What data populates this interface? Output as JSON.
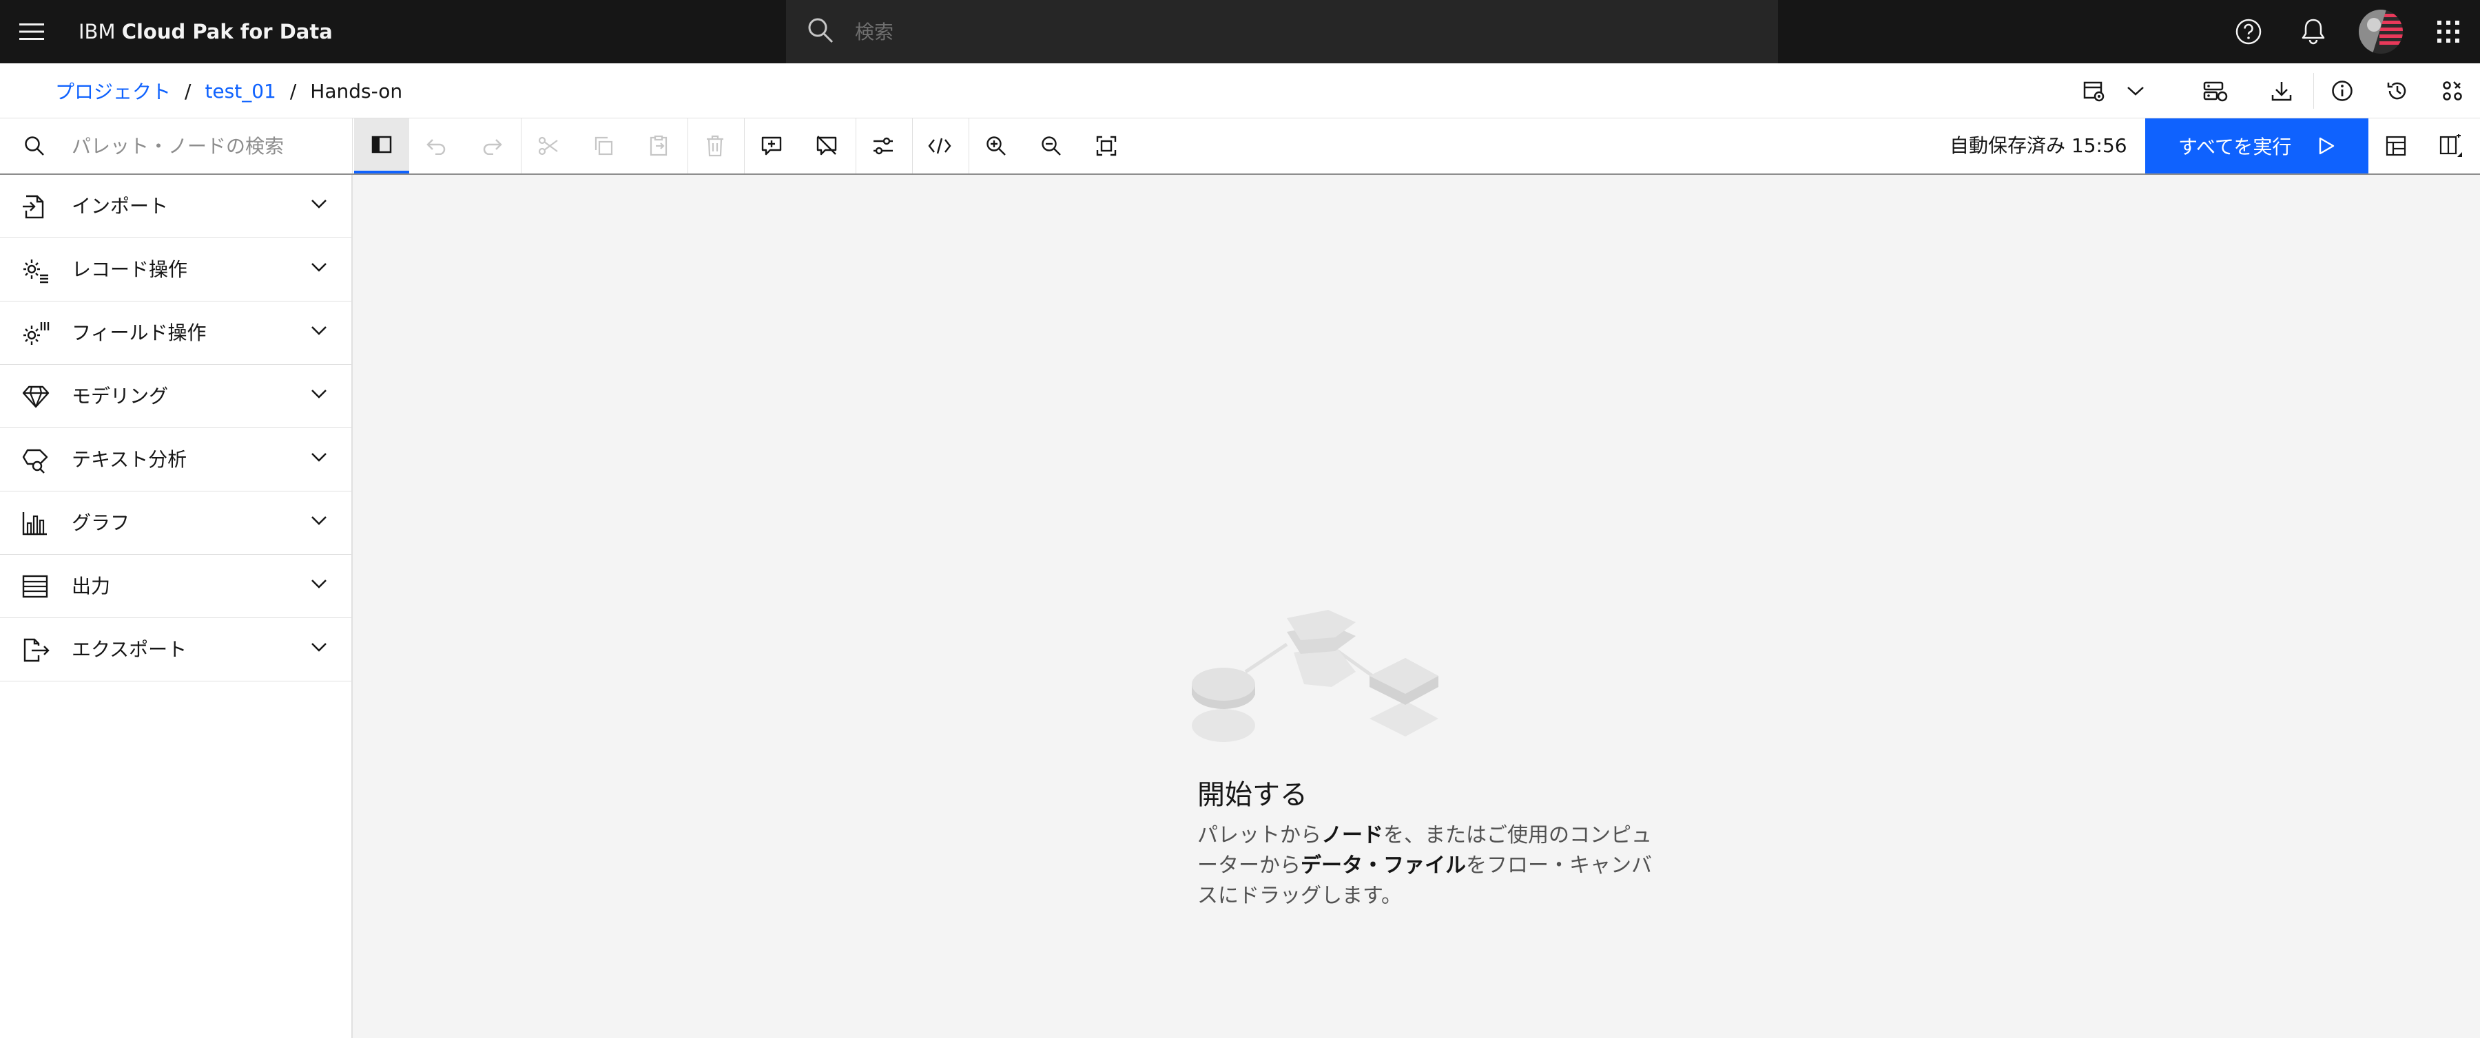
{
  "header": {
    "brand_prefix": "IBM",
    "brand_name": "Cloud Pak for Data",
    "search_placeholder": "検索",
    "icons": [
      "menu-icon",
      "search-icon",
      "help-icon",
      "notification-icon",
      "avatar",
      "app-switcher-icon"
    ]
  },
  "breadcrumb": {
    "items": [
      "プロジェクト",
      "test_01"
    ],
    "separator": "/",
    "current": "Hands-on"
  },
  "toolbar": {
    "palette_search_placeholder": "パレット・ノードの検索",
    "autosave_label": "自動保存済み 15:56",
    "run_all_label": "すべてを実行"
  },
  "palette": {
    "categories": [
      {
        "label": "インポート",
        "icon": "import-icon"
      },
      {
        "label": "レコード操作",
        "icon": "record-ops-icon"
      },
      {
        "label": "フィールド操作",
        "icon": "field-ops-icon"
      },
      {
        "label": "モデリング",
        "icon": "modeling-icon"
      },
      {
        "label": "テキスト分析",
        "icon": "text-analytics-icon"
      },
      {
        "label": "グラフ",
        "icon": "graph-icon"
      },
      {
        "label": "出力",
        "icon": "output-icon"
      },
      {
        "label": "エクスポート",
        "icon": "export-icon"
      }
    ]
  },
  "empty_state": {
    "title": "開始する",
    "desc_1": "パレットから",
    "desc_2": "ノード",
    "desc_3": "を、またはご使用のコンピューターから",
    "desc_4": "データ・ファイル",
    "desc_5": "をフロー・キャンバスにドラッグします。"
  },
  "colors": {
    "header_bg": "#161616",
    "primary": "#0f62fe",
    "canvas_bg": "#f4f4f4"
  }
}
